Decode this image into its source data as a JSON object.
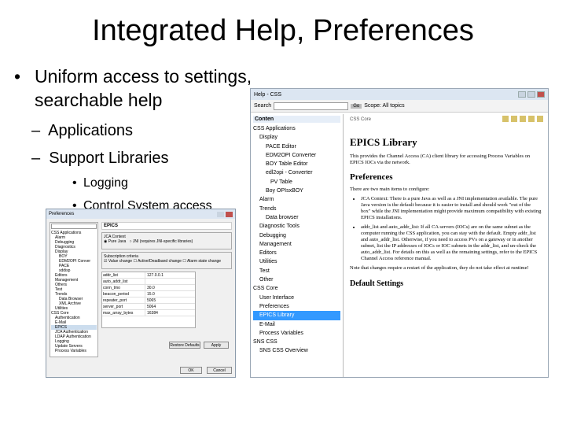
{
  "slide": {
    "title": "Integrated Help, Preferences",
    "bullet1_line1": "Uniform access to settings,",
    "bullet1_line2": "searchable help",
    "dash1": "Applications",
    "dash2": "Support Libraries",
    "sub1": "Logging",
    "sub2": "Control System access"
  },
  "help": {
    "window_title": "Help - CSS",
    "search_label": "Search",
    "go_label": "Go",
    "scope_label": "Scope: All topics",
    "toc_header": "Conten",
    "toc_items": [
      "CSS Applications",
      "Display",
      "PACE Editor",
      "EDM2OPI Converter",
      "BOY Table Editor",
      "edl2opi - Converter",
      "PV Table",
      "Boy OPIsxBOY",
      "Alarm",
      "Trends",
      "Data browser",
      "Diagnostic Tools",
      "Debugging",
      "Management",
      "Editors",
      "Utilities",
      "Test",
      "Other",
      "CSS Core",
      "User Interface",
      "Preferences",
      "EPICS Library",
      "E-Mail",
      "Process Variables",
      "SNS CSS",
      "SNS CSS Overview"
    ],
    "breadcrumb": "CSS Core",
    "h1": "EPICS Library",
    "intro": "This provides the Channel Access (CA) client library for accessing Process Variables on EPICS IOCs via the network.",
    "h2": "Preferences",
    "pref_intro": "There are two main items to configure:",
    "li1": "JCA Context: There is a pure Java as well as a JNI implementation available. The pure Java version is the default because it is easier to install and should work \"out of the box\" while the JNI implementation might provide maximum compatibility with existing EPICS installations.",
    "li2": "addr_list and auto_addr_list: If all CA servers (IOCs) are on the same subnet as the computer running the CSS application, you can stay with the default. Empty addr_list and auto_addr_list. Otherwise, if you need to access PVs on a gateway or in another subnet, list the IP addresses of IOCs or IOC subnets in the addr_list, and un-check the auto_addr_list. For details on this as well as the remaining settings, refer to the EPICS Channel Access reference manual.",
    "note": "Note that changes require a restart of the application, they do not take effect at runtime!",
    "h3": "Default Settings"
  },
  "pref": {
    "window_title": "Preferences",
    "tree": [
      "CSS Applications",
      "Alarm",
      "Debugging",
      "Diagnostics",
      "Display",
      "BOY",
      "EDM2OPI Conver",
      "PACE",
      "sddisp",
      "Editors",
      "Management",
      "Others",
      "Test",
      "Trends",
      "Data Browser",
      "XML Archive",
      "Utilities",
      "CSS Core",
      "Authentication",
      "E-Mail",
      "EPICS",
      "JCA Authentication",
      "LDAP Authentication",
      "Logging",
      "Update Servers",
      "Process Variables"
    ],
    "page_title": "EPICS",
    "jca_context": "JCA Context",
    "pure_java": "Pure Java",
    "jni": "JNI (requires JNI-specific libraries)",
    "subscription": "Subscription criteria",
    "value_change": "Value change",
    "active_change": "Active/Deadband change",
    "alarm_state": "Alarm state change",
    "table": [
      [
        "addr_list",
        "127.0.0.1"
      ],
      [
        "auto_addr_list",
        ""
      ],
      [
        "conn_tmo",
        "30.0"
      ],
      [
        "beacon_period",
        "15.0"
      ],
      [
        "repeater_port",
        "5065"
      ],
      [
        "server_port",
        "5064"
      ],
      [
        "max_array_bytes",
        "16384"
      ]
    ],
    "restore_btn": "Restore Defaults",
    "apply_btn": "Apply",
    "ok_btn": "OK",
    "cancel_btn": "Cancel"
  }
}
